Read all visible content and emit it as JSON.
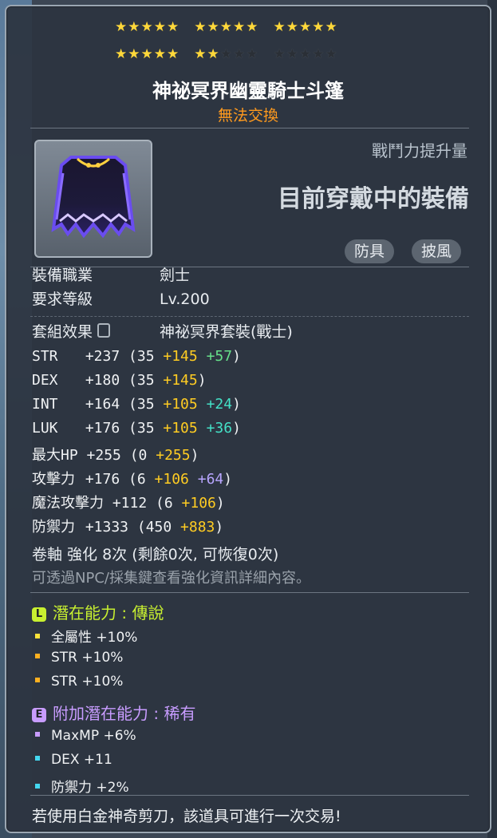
{
  "stars": {
    "filled": 22,
    "total": 30
  },
  "item": {
    "name": "神祕冥界幽靈騎士斗篷",
    "trade_status": "無法交換"
  },
  "power": {
    "label": "戰鬥力提升量",
    "current": "目前穿戴中的裝備"
  },
  "tags": [
    "防具",
    "披風"
  ],
  "requirements": {
    "job_label": "裝備職業",
    "job_value": "劍士",
    "level_label": "要求等級",
    "level_value": "Lv.200"
  },
  "set": {
    "label": "套組效果",
    "value": "神祕冥界套裝(戰士)"
  },
  "stats": [
    {
      "key": "STR",
      "total": "+237",
      "base": "(35",
      "bonus": "+145",
      "extra": "+57",
      "extra_color": "green",
      "close": ")"
    },
    {
      "key": "DEX",
      "total": "+180",
      "base": "(35",
      "bonus": "+145",
      "extra": "",
      "extra_color": "",
      "close": ")"
    },
    {
      "key": "INT",
      "total": "+164",
      "base": "(35",
      "bonus": "+105",
      "extra": "+24",
      "extra_color": "cyan",
      "close": ")"
    },
    {
      "key": "LUK",
      "total": "+176",
      "base": "(35",
      "bonus": "+105",
      "extra": "+36",
      "extra_color": "cyan",
      "close": ")"
    },
    {
      "key": "最大HP",
      "total": "+255",
      "base": "(0",
      "bonus": "+255",
      "extra": "",
      "extra_color": "",
      "close": ")"
    },
    {
      "key": "攻擊力",
      "total": "+176",
      "base": "(6",
      "bonus": "+106",
      "extra": "+64",
      "extra_color": "purple",
      "close": ")"
    },
    {
      "key": "魔法攻擊力",
      "total": "+112",
      "base": "(6",
      "bonus": "+106",
      "extra": "",
      "extra_color": "",
      "close": ")"
    },
    {
      "key": "防禦力",
      "total": "+1333",
      "base": "(450",
      "bonus": "+883",
      "extra": "",
      "extra_color": "",
      "close": ")"
    }
  ],
  "scroll": {
    "line": "卷軸 強化 8次 (剩餘0次, 可恢復0次)",
    "note": "可透過NPC/採集鍵查看強化資訊詳細內容。"
  },
  "potential": {
    "badge": "L",
    "title": "潛在能力 : 傳說",
    "color": "#c8f030",
    "lines": [
      {
        "text": "全屬性 +10%",
        "bullet": "#ffe23a"
      },
      {
        "text": "STR +10%",
        "bullet": "#ffb020"
      },
      {
        "text": "STR +10%",
        "bullet": "#ffb020"
      }
    ]
  },
  "additional": {
    "badge": "E",
    "title": "附加潛在能力 : 稀有",
    "color": "#c89cff",
    "lines": [
      {
        "text": "MaxMP +6%",
        "bullet": "#c89cff"
      },
      {
        "text": "DEX +11",
        "bullet": "#44d8f0"
      },
      {
        "text": "防禦力 +2%",
        "bullet": "#44d8f0"
      }
    ]
  },
  "footer": "若使用白金神奇剪刀，該道具可進行一次交易!"
}
